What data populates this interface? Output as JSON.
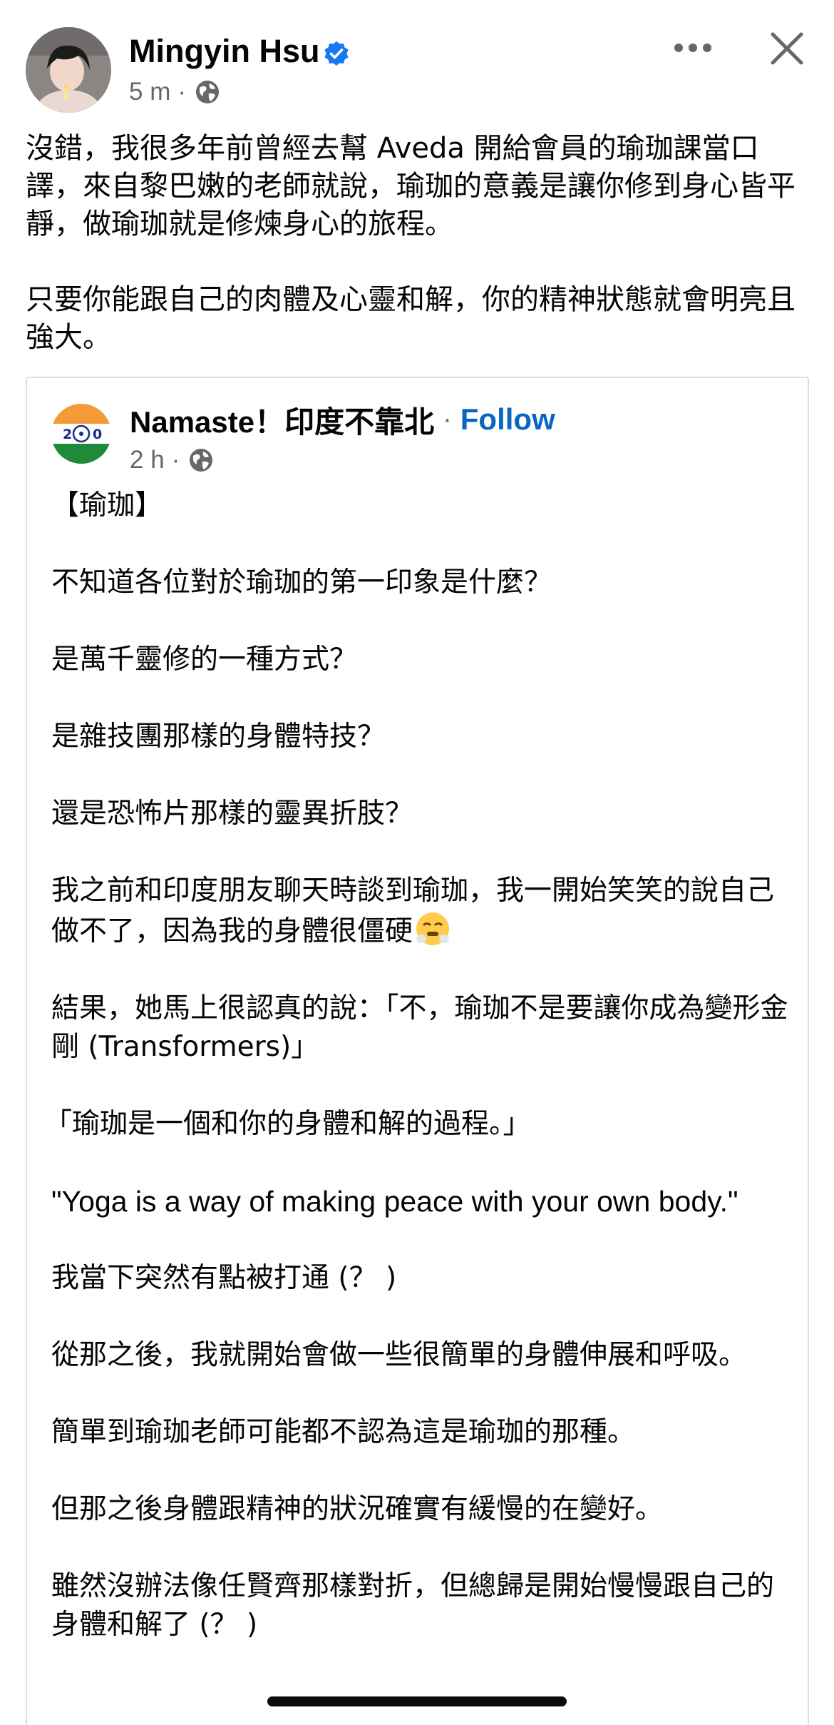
{
  "header": {
    "author_name": "Mingyin Hsu",
    "time": "5 m",
    "separator": "·",
    "icons": {
      "verified": "verified-badge-icon",
      "privacy": "globe-icon",
      "more": "more-options-icon",
      "close": "close-icon"
    },
    "colors": {
      "verified": "#1877f2",
      "meta": "#65676b"
    }
  },
  "caption": {
    "paragraphs": [
      "沒錯，我很多年前曾經去幫 Aveda 開給會員的瑜珈課當口譯，來自黎巴嫩的老師就說，瑜珈的意義是讓你修到身心皆平靜，做瑜珈就是修煉身心的旅程。",
      "只要你能跟自己的肉體及心靈和解，你的精神狀態就會明亮且強大。"
    ]
  },
  "shared_post": {
    "page_name": "Namaste！印度不靠北",
    "separator": "·",
    "follow_label": "Follow",
    "time": "2 h",
    "avatar_text": "2 ◎ 0",
    "colors": {
      "follow": "#0a66c2",
      "saffron": "#f29b38",
      "green": "#1f8a3a",
      "chakra": "#1a2b8c"
    },
    "paragraphs": [
      "【瑜珈】",
      "不知道各位對於瑜珈的第一印象是什麼？",
      "是萬千靈修的一種方式？",
      "是雜技團那樣的身體特技？",
      "還是恐怖片那樣的靈異折肢？",
      "我之前和印度朋友聊天時談到瑜珈，我一開始笑笑的說自己做不了，因為我的身體很僵硬",
      "結果，她馬上很認真的說：「不，瑜珈不是要讓你成為變形金剛 (Transformers)」",
      "「瑜珈是一個和你的身體和解的過程。」",
      "\"Yoga is a way of making peace with your own body.\"",
      "我當下突然有點被打通 (？ )",
      "從那之後，我就開始會做一些很簡單的身體伸展和呼吸。",
      "簡單到瑜珈老師可能都不認為這是瑜珈的那種。",
      "但那之後身體跟精神的狀況確實有緩慢的在變好。",
      "雖然沒辦法像任賢齊那樣對折，但總歸是開始慢慢跟自己的身體和解了 (？ )"
    ],
    "emoji_after_paragraph_6": "face-with-steam-emoji"
  }
}
